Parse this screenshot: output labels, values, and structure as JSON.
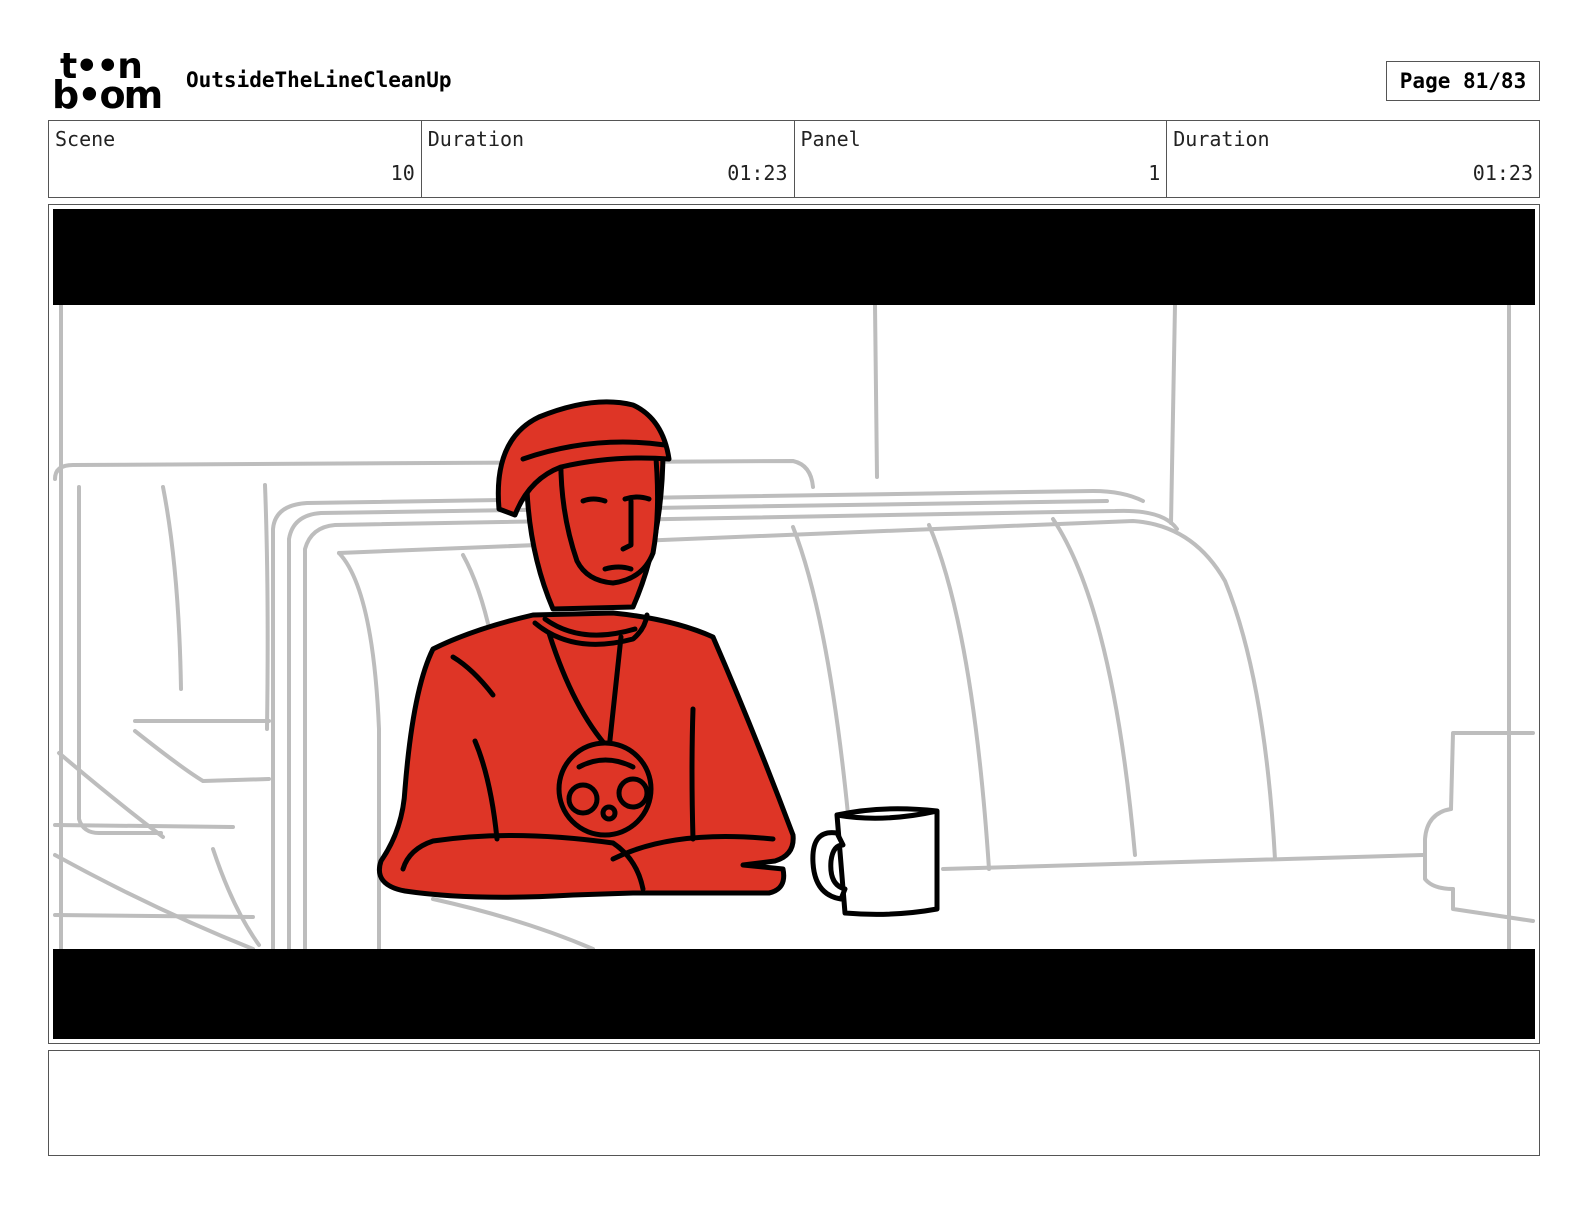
{
  "header": {
    "logo_top": "t••n",
    "logo_bottom": "b•om",
    "project_title": "OutsideTheLineCleanUp",
    "page_label": "Page 81/83"
  },
  "info": {
    "scene_label": "Scene",
    "scene_value": "10",
    "scene_duration_label": "Duration",
    "scene_duration_value": "01:23",
    "panel_label": "Panel",
    "panel_value": "1",
    "panel_duration_label": "Duration",
    "panel_duration_value": "01:23"
  },
  "panel": {
    "character_color": "#de3526",
    "line_color": "#000000",
    "background_line_color": "#bdbdbd",
    "letterbox_color": "#000000"
  },
  "notes": {
    "text": ""
  }
}
